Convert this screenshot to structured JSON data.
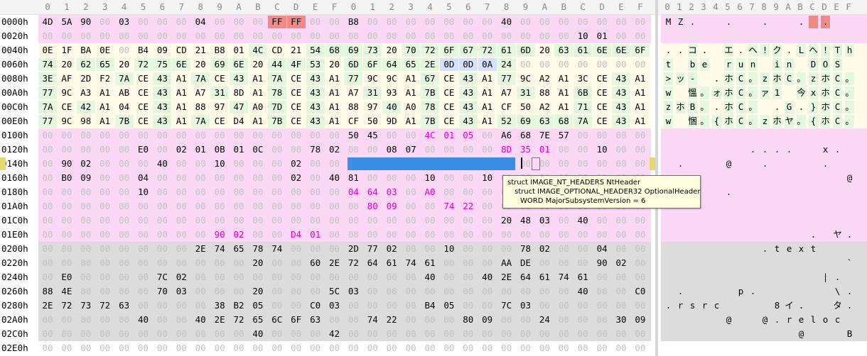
{
  "header": {
    "hex_columns": [
      "0",
      "1",
      "2",
      "3",
      "4",
      "5",
      "6",
      "7",
      "8",
      "9",
      "A",
      "B",
      "C",
      "D",
      "E",
      "F",
      "0",
      "1",
      "2",
      "3",
      "4",
      "5",
      "6",
      "7",
      "8",
      "9",
      "A",
      "B",
      "C",
      "D",
      "E",
      "F"
    ],
    "ascii_columns": [
      "0",
      "1",
      "2",
      "3",
      "4",
      "5",
      "6",
      "7",
      "8",
      "9",
      "A",
      "B",
      "C",
      "D",
      "E",
      "F"
    ]
  },
  "rows": [
    {
      "addr": "0000h",
      "bytes": [
        "4D",
        "5A",
        "90",
        "00",
        "03",
        "00",
        "00",
        "00",
        "04",
        "00",
        "00",
        "00",
        "FF",
        "FF",
        "00",
        "00",
        "B8",
        "00",
        "00",
        "00",
        "00",
        "00",
        "00",
        "00",
        "40",
        "00",
        "00",
        "00",
        "00",
        "00",
        "00",
        "00"
      ],
      "ascii": [
        "M",
        "Z",
        ".",
        "",
        "",
        ".",
        "",
        "",
        ".",
        "",
        "",
        ".",
        "",
        ".",
        "",
        ""
      ]
    },
    {
      "addr": "0020h",
      "bytes": [
        "00",
        "00",
        "00",
        "00",
        "00",
        "00",
        "00",
        "00",
        "00",
        "00",
        "00",
        "00",
        "00",
        "00",
        "00",
        "00",
        "00",
        "00",
        "00",
        "00",
        "00",
        "00",
        "00",
        "00",
        "00",
        "00",
        "00",
        "00",
        "10",
        "01",
        "00",
        "00"
      ],
      "ascii": [
        "",
        "",
        "",
        "",
        "",
        "",
        "",
        "",
        "",
        "",
        "",
        "",
        "",
        "",
        "",
        ""
      ]
    },
    {
      "addr": "0040h",
      "bytes": [
        "0E",
        "1F",
        "BA",
        "0E",
        "00",
        "B4",
        "09",
        "CD",
        "21",
        "B8",
        "01",
        "4C",
        "CD",
        "21",
        "54",
        "68",
        "69",
        "73",
        "20",
        "70",
        "72",
        "6F",
        "67",
        "72",
        "61",
        "6D",
        "20",
        "63",
        "61",
        "6E",
        "6E",
        "6F"
      ],
      "ascii": [
        ".",
        ".",
        "コ",
        ".",
        "",
        "エ",
        ".",
        "ヘ",
        "!",
        "ク",
        ".",
        "L",
        "ヘ",
        "!",
        "T",
        "h"
      ]
    },
    {
      "addr": "0060h",
      "bytes": [
        "74",
        "20",
        "62",
        "65",
        "20",
        "72",
        "75",
        "6E",
        "20",
        "69",
        "6E",
        "20",
        "44",
        "4F",
        "53",
        "20",
        "6D",
        "6F",
        "64",
        "65",
        "2E",
        "0D",
        "0D",
        "0A",
        "24",
        "00",
        "00",
        "00",
        "00",
        "00",
        "00",
        "00"
      ],
      "ascii": [
        "t",
        "",
        "b",
        "e",
        "",
        "r",
        "u",
        "n",
        "",
        "i",
        "n",
        "",
        "D",
        "O",
        "S",
        ""
      ]
    },
    {
      "addr": "0080h",
      "bytes": [
        "3E",
        "AF",
        "2D",
        "F2",
        "7A",
        "CE",
        "43",
        "A1",
        "7A",
        "CE",
        "43",
        "A1",
        "7A",
        "CE",
        "43",
        "A1",
        "77",
        "9C",
        "9C",
        "A1",
        "67",
        "CE",
        "43",
        "A1",
        "77",
        "9C",
        "A2",
        "A1",
        "3C",
        "CE",
        "43",
        "A1"
      ],
      "ascii": [
        ">",
        "ッ",
        "-",
        "",
        ".",
        "ホ",
        "C",
        "。",
        "z",
        "ホ",
        "C",
        "。",
        "z",
        "ホ",
        "C",
        "。"
      ]
    },
    {
      "addr": "00A0h",
      "bytes": [
        "77",
        "9C",
        "A3",
        "A1",
        "AB",
        "CE",
        "43",
        "A1",
        "A7",
        "31",
        "8D",
        "A1",
        "78",
        "CE",
        "43",
        "A1",
        "A7",
        "31",
        "93",
        "A1",
        "7B",
        "CE",
        "43",
        "A1",
        "A7",
        "31",
        "88",
        "A1",
        "6B",
        "CE",
        "43",
        "A1"
      ],
      "ascii": [
        "w",
        "",
        "慍",
        "。",
        "ォ",
        "ホ",
        "C",
        "。",
        "ァ",
        "1",
        "",
        "今",
        "x",
        "ホ",
        "C",
        "。"
      ]
    },
    {
      "addr": "00C0h",
      "bytes": [
        "7A",
        "CE",
        "42",
        "A1",
        "04",
        "CE",
        "43",
        "A1",
        "88",
        "97",
        "47",
        "A0",
        "7D",
        "CE",
        "43",
        "A1",
        "88",
        "97",
        "40",
        "A0",
        "78",
        "CE",
        "43",
        "A1",
        "CF",
        "50",
        "A2",
        "A1",
        "71",
        "CE",
        "43",
        "A1"
      ],
      "ascii": [
        "z",
        "ホ",
        "B",
        "。",
        ".",
        "ホ",
        "C",
        "。",
        "",
        ".",
        "G",
        ".",
        "}",
        "ホ",
        "C",
        "。"
      ]
    },
    {
      "addr": "00E0h",
      "bytes": [
        "77",
        "9C",
        "98",
        "A1",
        "7B",
        "CE",
        "43",
        "A1",
        "7A",
        "CE",
        "D4",
        "A1",
        "7B",
        "CE",
        "43",
        "A1",
        "CF",
        "50",
        "9D",
        "A1",
        "7B",
        "CE",
        "43",
        "A1",
        "52",
        "69",
        "63",
        "68",
        "7A",
        "CE",
        "43",
        "A1"
      ],
      "ascii": [
        "w",
        "",
        "悃",
        "。",
        "{",
        "ホ",
        "C",
        "。",
        "z",
        "ホ",
        "ヤ",
        "。",
        "{",
        "ホ",
        "C",
        "。"
      ]
    },
    {
      "addr": "0100h",
      "bytes": [
        "00",
        "00",
        "00",
        "00",
        "00",
        "00",
        "00",
        "00",
        "00",
        "00",
        "00",
        "00",
        "00",
        "00",
        "00",
        "00",
        "50",
        "45",
        "00",
        "00",
        "4C",
        "01",
        "05",
        "00",
        "A6",
        "68",
        "7E",
        "57",
        "00",
        "00",
        "00",
        "00"
      ],
      "ascii": [
        "",
        "",
        "",
        "",
        "",
        "",
        "",
        "",
        "",
        "",
        "",
        "",
        "",
        "",
        "",
        ""
      ]
    },
    {
      "addr": "0120h",
      "bytes": [
        "00",
        "00",
        "00",
        "00",
        "00",
        "E0",
        "00",
        "02",
        "01",
        "0B",
        "01",
        "0C",
        "00",
        "00",
        "78",
        "02",
        "00",
        "00",
        "08",
        "07",
        "00",
        "00",
        "00",
        "00",
        "8D",
        "35",
        "01",
        "00",
        "00",
        "10",
        "00",
        "00"
      ],
      "ascii": [
        "",
        "",
        "",
        "",
        "",
        "",
        "",
        ".",
        ".",
        ".",
        ".",
        "",
        "",
        "x",
        ".",
        ""
      ]
    },
    {
      "addr": "0140h",
      "bytes": [
        "00",
        "90",
        "02",
        "00",
        "00",
        "00",
        "40",
        "00",
        "00",
        "10",
        "00",
        "00",
        "00",
        "02",
        "00",
        "00",
        "06",
        "00",
        "00",
        "00",
        "00",
        "00",
        "00",
        "00",
        "06",
        "00",
        "00",
        "00",
        "00",
        "00",
        "00",
        "00"
      ],
      "ascii": [
        "",
        ".",
        "",
        "",
        "",
        "@",
        "",
        "",
        ".",
        "",
        "",
        "",
        "",
        ".",
        "",
        ""
      ]
    },
    {
      "addr": "0160h",
      "bytes": [
        "00",
        "B0",
        "09",
        "00",
        "00",
        "04",
        "00",
        "00",
        "00",
        "00",
        "00",
        "00",
        "00",
        "02",
        "00",
        "40",
        "81",
        "00",
        "00",
        "00",
        "10",
        "00",
        "00",
        "10",
        "00",
        "00",
        "00",
        "00",
        "00",
        "00",
        "00",
        "00"
      ],
      "ascii": [
        "",
        ".",
        "",
        "",
        "",
        "",
        "",
        "",
        "",
        "",
        "",
        "",
        "",
        "",
        "",
        "@"
      ]
    },
    {
      "addr": "0180h",
      "bytes": [
        "00",
        "00",
        "00",
        "00",
        "00",
        "10",
        "00",
        "00",
        "00",
        "00",
        "00",
        "00",
        "00",
        "00",
        "00",
        "00",
        "04",
        "64",
        "03",
        "00",
        "A0",
        "00",
        "00",
        "00",
        "00",
        "00",
        "00",
        "00",
        "00",
        "00",
        "00",
        "00"
      ],
      "ascii": [
        "",
        "",
        "",
        "",
        "",
        ".",
        "",
        "",
        "",
        "",
        "",
        "",
        "",
        "",
        "",
        ""
      ]
    },
    {
      "addr": "01A0h",
      "bytes": [
        "00",
        "00",
        "00",
        "00",
        "00",
        "00",
        "00",
        "00",
        "00",
        "00",
        "00",
        "00",
        "00",
        "00",
        "00",
        "00",
        "00",
        "80",
        "09",
        "00",
        "00",
        "74",
        "22",
        "00",
        "00",
        "00",
        "00",
        "00",
        "00",
        "00",
        "00",
        "00"
      ],
      "ascii": [
        "",
        "",
        "",
        "",
        "",
        "",
        "",
        "",
        "",
        "",
        "",
        "",
        "",
        "",
        "",
        ""
      ]
    },
    {
      "addr": "01C0h",
      "bytes": [
        "00",
        "00",
        "00",
        "00",
        "00",
        "00",
        "00",
        "00",
        "00",
        "00",
        "00",
        "00",
        "00",
        "00",
        "00",
        "00",
        "00",
        "00",
        "00",
        "00",
        "00",
        "00",
        "00",
        "00",
        "20",
        "48",
        "03",
        "00",
        "40",
        "00",
        "00",
        "00"
      ],
      "ascii": [
        "",
        "",
        "",
        "",
        "",
        "",
        "",
        "",
        "",
        "",
        "",
        "",
        "",
        "",
        "",
        ""
      ]
    },
    {
      "addr": "01E0h",
      "bytes": [
        "00",
        "00",
        "00",
        "00",
        "00",
        "00",
        "00",
        "00",
        "00",
        "90",
        "02",
        "00",
        "00",
        "D4",
        "01",
        "00",
        "00",
        "00",
        "00",
        "00",
        "00",
        "00",
        "00",
        "00",
        "00",
        "00",
        "00",
        "00",
        "00",
        "00",
        "00",
        "00"
      ],
      "ascii": [
        "",
        "",
        "",
        "",
        "",
        "",
        "",
        "",
        "",
        "",
        "",
        "",
        ".",
        "",
        "ヤ",
        "."
      ]
    },
    {
      "addr": "0200h",
      "bytes": [
        "00",
        "00",
        "00",
        "00",
        "00",
        "00",
        "00",
        "00",
        "2E",
        "74",
        "65",
        "78",
        "74",
        "00",
        "00",
        "00",
        "2D",
        "77",
        "02",
        "00",
        "00",
        "10",
        "00",
        "00",
        "00",
        "78",
        "02",
        "00",
        "00",
        "04",
        "00",
        "00"
      ],
      "ascii": [
        "",
        "",
        "",
        "",
        "",
        "",
        "",
        "",
        ".",
        "t",
        "e",
        "x",
        "t",
        "",
        "",
        ""
      ]
    },
    {
      "addr": "0220h",
      "bytes": [
        "00",
        "00",
        "00",
        "00",
        "00",
        "00",
        "00",
        "00",
        "00",
        "00",
        "00",
        "20",
        "00",
        "00",
        "60",
        "2E",
        "72",
        "64",
        "61",
        "74",
        "61",
        "00",
        "00",
        "00",
        "AA",
        "DE",
        "00",
        "00",
        "00",
        "90",
        "02",
        "00"
      ],
      "ascii": [
        "",
        "",
        "",
        "",
        "",
        "",
        "",
        "",
        "",
        "",
        "",
        "",
        "",
        "",
        "",
        "`"
      ]
    },
    {
      "addr": "0240h",
      "bytes": [
        "00",
        "E0",
        "00",
        "00",
        "00",
        "00",
        "7C",
        "02",
        "00",
        "00",
        "00",
        "00",
        "00",
        "00",
        "00",
        "00",
        "00",
        "00",
        "00",
        "00",
        "40",
        "00",
        "00",
        "40",
        "2E",
        "64",
        "61",
        "74",
        "61",
        "00",
        "00",
        "00"
      ],
      "ascii": [
        "",
        "",
        "",
        "",
        "",
        "",
        "",
        "",
        "",
        "",
        "",
        "",
        "",
        "|",
        ".",
        ""
      ]
    },
    {
      "addr": "0260h",
      "bytes": [
        "88",
        "4E",
        "00",
        "00",
        "00",
        "00",
        "70",
        "03",
        "00",
        "00",
        "00",
        "20",
        "00",
        "00",
        "00",
        "5C",
        "03",
        "00",
        "00",
        "00",
        "00",
        "00",
        "00",
        "00",
        "00",
        "00",
        "00",
        "00",
        "40",
        "00",
        "00",
        "C0"
      ],
      "ascii": [
        "",
        ".",
        "",
        "",
        "",
        "",
        "p",
        ".",
        "",
        "",
        "",
        "",
        "",
        "",
        "\\",
        "."
      ]
    },
    {
      "addr": "0280h",
      "bytes": [
        "2E",
        "72",
        "73",
        "72",
        "63",
        "00",
        "00",
        "00",
        "00",
        "38",
        "B2",
        "05",
        "00",
        "00",
        "C0",
        "03",
        "00",
        "00",
        "00",
        "00",
        "B4",
        "05",
        "00",
        "00",
        "7C",
        "03",
        "00",
        "00",
        "00",
        "00",
        "00",
        "00"
      ],
      "ascii": [
        ".",
        "r",
        "s",
        "r",
        "c",
        "",
        "",
        "",
        "",
        "8",
        "イ",
        ".",
        "",
        "",
        "タ",
        "."
      ]
    },
    {
      "addr": "02A0h",
      "bytes": [
        "00",
        "00",
        "00",
        "00",
        "00",
        "40",
        "00",
        "00",
        "40",
        "2E",
        "72",
        "65",
        "6C",
        "6F",
        "63",
        "00",
        "00",
        "74",
        "22",
        "00",
        "00",
        "00",
        "80",
        "09",
        "00",
        "00",
        "24",
        "00",
        "00",
        "00",
        "30",
        "09"
      ],
      "ascii": [
        "",
        "",
        "",
        "",
        "",
        "@",
        "",
        "",
        "@",
        ".",
        "r",
        "e",
        "l",
        "o",
        "c",
        ""
      ]
    },
    {
      "addr": "02C0h",
      "bytes": [
        "00",
        "00",
        "00",
        "00",
        "00",
        "00",
        "00",
        "00",
        "00",
        "00",
        "00",
        "40",
        "00",
        "00",
        "00",
        "42",
        "00",
        "00",
        "00",
        "00",
        "00",
        "00",
        "00",
        "00",
        "00",
        "00",
        "00",
        "00",
        "00",
        "00",
        "00",
        "00"
      ],
      "ascii": [
        "",
        "",
        "",
        "",
        "",
        "",
        "",
        "",
        "",
        "",
        "",
        "@",
        "",
        "",
        "",
        "B"
      ]
    },
    {
      "addr": "02E0h",
      "bytes": [
        "00",
        "00",
        "00",
        "00",
        "00",
        "00",
        "00",
        "00",
        "00",
        "00",
        "00",
        "00",
        "00",
        "00",
        "00",
        "00",
        "00",
        "00",
        "00",
        "00",
        "00",
        "00",
        "00",
        "00",
        "00",
        "00",
        "00",
        "00",
        "00",
        "00",
        "00",
        "00"
      ],
      "ascii": [
        "",
        "",
        "",
        "",
        "",
        "",
        "",
        "",
        "",
        "",
        "",
        "",
        "",
        "",
        "",
        ""
      ]
    }
  ],
  "tooltip": {
    "line1": "struct IMAGE_NT_HEADERS NtHeader",
    "line2": "struct IMAGE_OPTIONAL_HEADER32 OptionalHeader",
    "line3": "WORD MajorSubsystemVersion = 6"
  },
  "colors": {
    "dos_header_bg": "#fcd8f7",
    "stub_bg": "#fffbe8",
    "stub_green": "#e3f8de",
    "nt_header_bg": "#fcd8f7",
    "section_header_bg": "#dcdcdc",
    "selection": "#3b8ee6",
    "magenta_text": "#e000d0",
    "red_box": "#f08a86",
    "zero_text": "#c2c2c2"
  }
}
